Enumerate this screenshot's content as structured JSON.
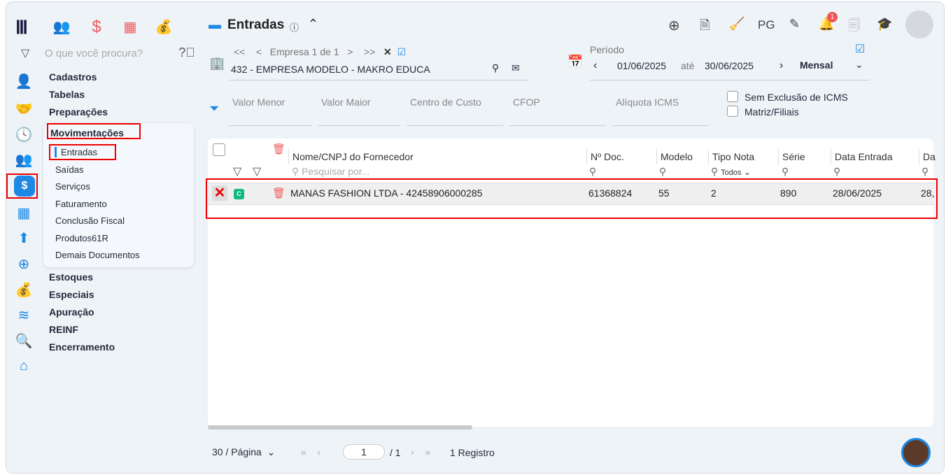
{
  "header": {
    "title": "Entradas",
    "info": "ⓘ"
  },
  "toolbar": {
    "pg": "PG",
    "notif_count": "1"
  },
  "sidebar": {
    "search_placeholder": "O que você procura?",
    "items": [
      "Cadastros",
      "Tabelas",
      "Preparações",
      "Movimentações",
      "Estoques",
      "Especiais",
      "Apuração",
      "REINF",
      "Encerramento"
    ],
    "sub_items": [
      "Entradas",
      "Saídas",
      "Serviços",
      "Faturamento",
      "Conclusão Fiscal",
      "Produtos61R",
      "Demais Documentos"
    ]
  },
  "empresa": {
    "nav": "Empresa 1 de 1",
    "name": "432 - EMPRESA MODELO - MAKRO EDUCA"
  },
  "periodo": {
    "label": "Período",
    "start": "01/06/2025",
    "ate": "até",
    "end": "30/06/2025",
    "mode": "Mensal"
  },
  "filters": {
    "valor_menor": "Valor Menor",
    "valor_maior": "Valor Maior",
    "centro": "Centro de Custo",
    "cfop": "CFOP",
    "aliquota": "Alíquota ICMS",
    "sem_exclusao": "Sem Exclusão de ICMS",
    "matriz": "Matriz/Filiais"
  },
  "table": {
    "headers": [
      "Nome/CNPJ do Fornecedor",
      "Nº Doc.",
      "Modelo",
      "Tipo Nota",
      "Série",
      "Data Entrada",
      "Da"
    ],
    "search_placeholder": "Pesquisar por...",
    "tipo_filter": "Todos",
    "row": {
      "badge": "C",
      "nome": "MANAS FASHION LTDA - 42458906000285",
      "doc": "61368824",
      "modelo": "55",
      "tipo": "2",
      "serie": "890",
      "data": "28/06/2025",
      "cut": "28,"
    }
  },
  "footer": {
    "per_page": "30 / Página",
    "page": "1",
    "total_pages": "/ 1",
    "records": "1 Registro"
  }
}
